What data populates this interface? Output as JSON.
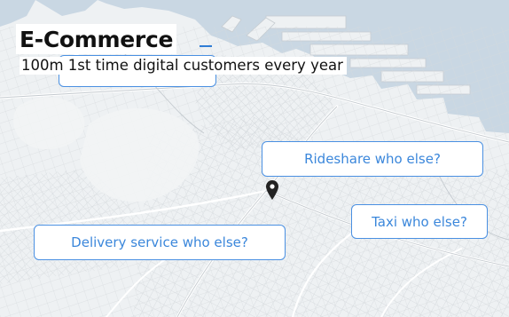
{
  "header": {
    "title": "E-Commerce",
    "subtitle": "100m 1st time digital customers every year"
  },
  "callouts": [
    {
      "label": "Rideshare who else?"
    },
    {
      "label": "Taxi who else?"
    },
    {
      "label": "Delivery service who else?"
    }
  ],
  "map": {
    "icon": "location-pin-icon",
    "colors": {
      "water": "#c9d7e3",
      "land": "#eef1f3",
      "roads": "#cfd4d8",
      "callout_border": "#4a90e2",
      "callout_text": "#3b87db"
    }
  }
}
